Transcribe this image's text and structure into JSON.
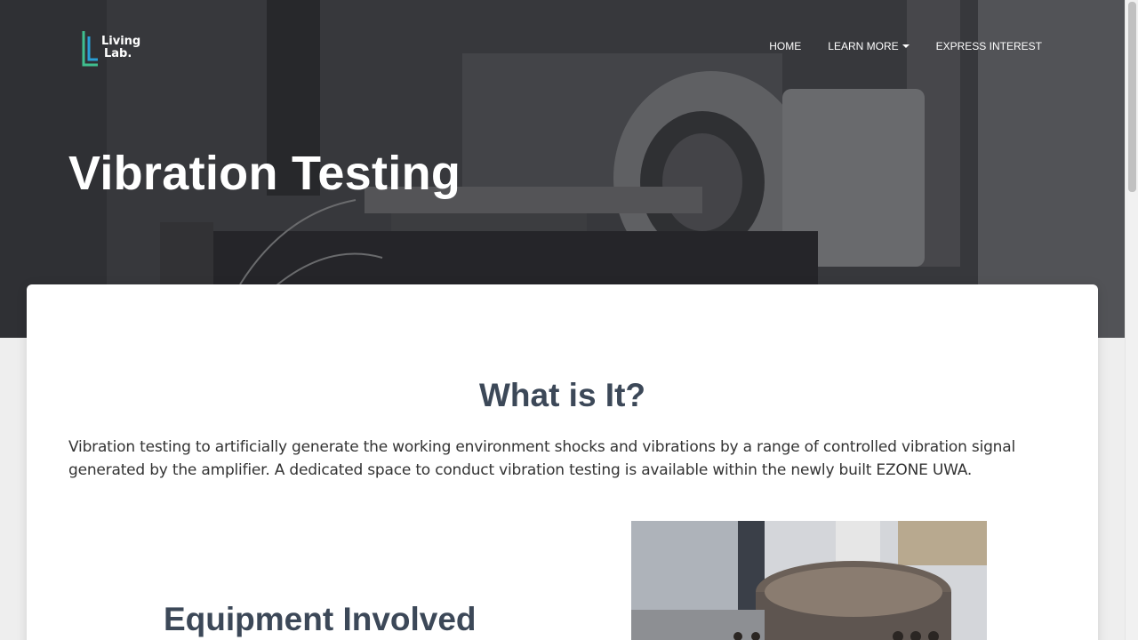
{
  "brand": {
    "logo_line1": "Living",
    "logo_line2": "Lab.",
    "logo_colors": [
      "#3fbf8f",
      "#2a9fd6"
    ]
  },
  "nav": {
    "items": [
      {
        "label": "HOME"
      },
      {
        "label": "LEARN MORE",
        "has_dropdown": true
      },
      {
        "label": "EXPRESS INTEREST"
      }
    ]
  },
  "hero": {
    "title": "Vibration Testing"
  },
  "content": {
    "section_title": "What is It?",
    "section_text": "Vibration testing to artificially generate the working environment shocks and vibrations by a range of controlled vibration signal generated by the amplifier. A dedicated space to conduct vibration testing is available within the newly built EZONE UWA.",
    "equipment_title": "Equipment Involved"
  },
  "colors": {
    "heading": "#3c4858",
    "body_text": "#333333"
  },
  "icons": {
    "caret": "caret-down-icon"
  }
}
